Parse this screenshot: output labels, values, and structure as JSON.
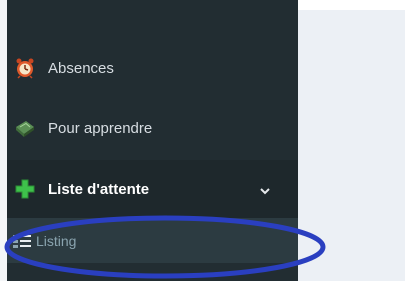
{
  "sidebar": {
    "items": [
      {
        "label": "",
        "icon": "calendar-icon"
      },
      {
        "label": "Absences",
        "icon": "alarm-clock-icon"
      },
      {
        "label": "Pour apprendre",
        "icon": "book-icon"
      },
      {
        "label": "Liste d'attente",
        "icon": "plus-icon",
        "expanded": true,
        "chevron": "chevron-down-icon"
      },
      {
        "label": "Listing",
        "icon": "list-icon"
      }
    ]
  },
  "colors": {
    "sidebar_bg": "#222d32",
    "active_bg": "#1e282c",
    "submenu_bg": "#2c3b41",
    "content_bg": "#ecf0f5",
    "plus_green": "#3ec14b",
    "annotation_blue": "#2a3fc0"
  }
}
